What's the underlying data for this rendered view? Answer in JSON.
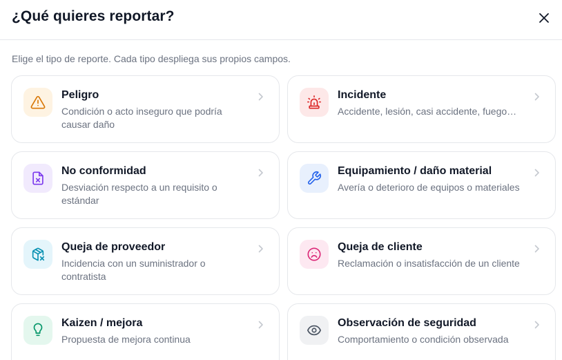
{
  "dialog": {
    "title": "¿Qué quieres reportar?",
    "subtitle": "Elige el tipo de reporte. Cada tipo despliega sus propios campos.",
    "close_icon": "close-icon"
  },
  "colors": {
    "chevron": "#c4c8cf",
    "peligro": {
      "bg": "#fef3e2",
      "fg": "#d97706"
    },
    "incidente": {
      "bg": "#fde8e8",
      "fg": "#dc2626"
    },
    "no_conformidad": {
      "bg": "#f1eafd",
      "fg": "#7c3aed"
    },
    "equipamiento": {
      "bg": "#e8f0fd",
      "fg": "#2563eb"
    },
    "queja_proveedor": {
      "bg": "#e4f5fb",
      "fg": "#0891b2"
    },
    "queja_cliente": {
      "bg": "#fde8f1",
      "fg": "#db2777"
    },
    "kaizen": {
      "bg": "#e4f7ee",
      "fg": "#059669"
    },
    "observacion": {
      "bg": "#f0f1f3",
      "fg": "#4b5563"
    }
  },
  "cards": [
    {
      "key": "peligro",
      "title": "Peligro",
      "description": "Condición o acto inseguro que podría causar daño",
      "icon": "warning-triangle-icon"
    },
    {
      "key": "incidente",
      "title": "Incidente",
      "description": "Accidente, lesión, casi accidente, fuego…",
      "icon": "siren-icon"
    },
    {
      "key": "no_conformidad",
      "title": "No conformidad",
      "description": "Desviación respecto a un requisito o estándar",
      "icon": "file-x-icon"
    },
    {
      "key": "equipamiento",
      "title": "Equipamiento / daño material",
      "description": "Avería o deterioro de equipos o materiales",
      "icon": "wrench-icon"
    },
    {
      "key": "queja_proveedor",
      "title": "Queja de proveedor",
      "description": "Incidencia con un suministrador o contratista",
      "icon": "package-x-icon"
    },
    {
      "key": "queja_cliente",
      "title": "Queja de cliente",
      "description": "Reclamación o insatisfacción de un cliente",
      "icon": "frown-icon"
    },
    {
      "key": "kaizen",
      "title": "Kaizen / mejora",
      "description": "Propuesta de mejora continua",
      "icon": "lightbulb-icon"
    },
    {
      "key": "observacion",
      "title": "Observación de seguridad",
      "description": "Comportamiento o condición observada",
      "icon": "eye-icon"
    }
  ]
}
